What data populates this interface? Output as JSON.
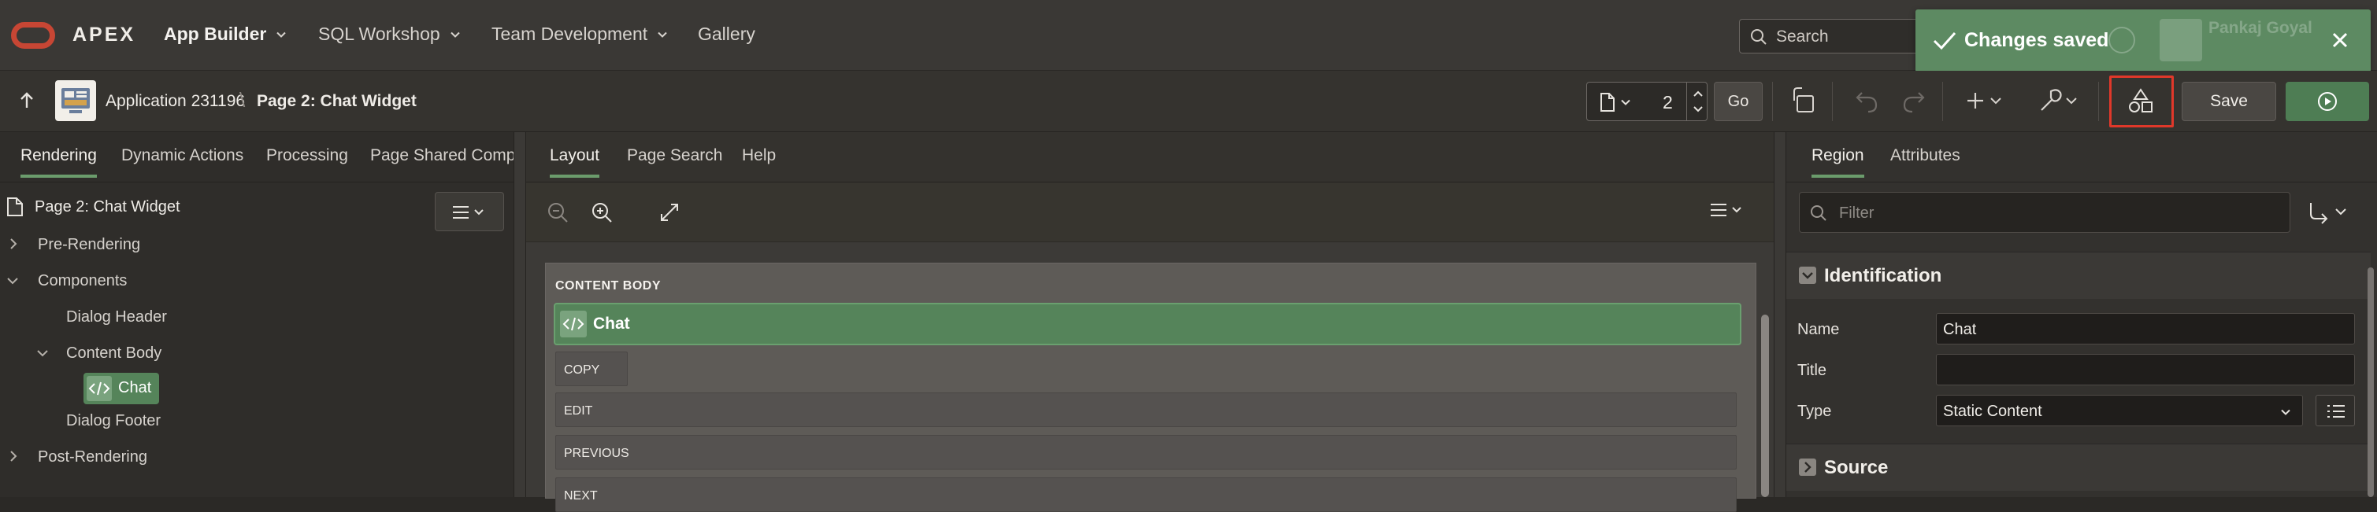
{
  "topnav": {
    "brand": "APEX",
    "items": [
      {
        "label": "App Builder",
        "has_menu": true
      },
      {
        "label": "SQL Workshop",
        "has_menu": true
      },
      {
        "label": "Team Development",
        "has_menu": true
      },
      {
        "label": "Gallery",
        "has_menu": false
      }
    ],
    "search_placeholder": "Search",
    "user_name": "Pankaj Goyal"
  },
  "toast": {
    "message": "Changes saved"
  },
  "toolbar": {
    "app_name": "Application 231196",
    "separator": "\\",
    "page_name": "Page 2: Chat Widget",
    "page_number": "2",
    "go_label": "Go",
    "save_label": "Save"
  },
  "left": {
    "tabs": [
      "Rendering",
      "Dynamic Actions",
      "Processing",
      "Page Shared Compor"
    ],
    "tree_root": "Page 2: Chat Widget",
    "nodes": {
      "pre_rendering": "Pre-Rendering",
      "components": "Components",
      "dialog_header": "Dialog Header",
      "content_body": "Content Body",
      "chat": "Chat",
      "dialog_footer": "Dialog Footer",
      "post_rendering": "Post-Rendering"
    }
  },
  "center": {
    "tabs": [
      "Layout",
      "Page Search",
      "Help"
    ],
    "region_label": "CONTENT BODY",
    "chat_region": "Chat",
    "slots": [
      "COPY",
      "EDIT",
      "PREVIOUS",
      "NEXT"
    ]
  },
  "right": {
    "tabs": [
      "Region",
      "Attributes"
    ],
    "filter_placeholder": "Filter",
    "sections": {
      "identification": "Identification",
      "source": "Source"
    },
    "props": {
      "name_label": "Name",
      "name_value": "Chat",
      "title_label": "Title",
      "title_value": "",
      "type_label": "Type",
      "type_value": "Static Content"
    }
  },
  "colors": {
    "accent_green": "#55845a",
    "toast_green": "#5d8a62",
    "highlight_red": "#e0382a",
    "oracle_red": "#c74634"
  }
}
